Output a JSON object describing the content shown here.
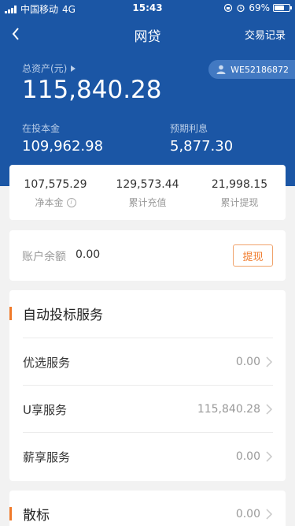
{
  "status_bar": {
    "carrier": "中国移动",
    "network": "4G",
    "time": "15:43",
    "battery": "69%",
    "battery_level": 0.69
  },
  "nav": {
    "title": "网贷",
    "right_link": "交易记录"
  },
  "overview": {
    "total_assets_label": "总资产(元)",
    "total_assets_value": "115,840.28",
    "user_id": "WE52186872",
    "invested_label": "在投本金",
    "invested_value": "109,962.98",
    "expected_interest_label": "预期利息",
    "expected_interest_value": "5,877.30"
  },
  "summary": [
    {
      "value": "107,575.29",
      "label": "净本金"
    },
    {
      "value": "129,573.44",
      "label": "累计充值"
    },
    {
      "value": "21,998.15",
      "label": "累计提现"
    }
  ],
  "balance": {
    "label": "账户余额",
    "value": "0.00",
    "withdraw_label": "提现"
  },
  "auto_service": {
    "title": "自动投标服务",
    "rows": [
      {
        "name": "优选服务",
        "value": "0.00"
      },
      {
        "name": "U享服务",
        "value": "115,840.28"
      },
      {
        "name": "薪享服务",
        "value": "0.00"
      }
    ]
  },
  "sanbiao": {
    "title": "散标",
    "value": "0.00"
  },
  "colors": {
    "primary": "#1b56a5",
    "accent": "#f07a2a",
    "background": "#f2f2f2"
  },
  "icons": [
    "signal-bars-icon",
    "lock-rotation-icon",
    "alarm-icon",
    "battery-icon",
    "back-arrow-icon",
    "play-triangle-icon",
    "user-icon",
    "info-icon",
    "chevron-right-icon"
  ]
}
